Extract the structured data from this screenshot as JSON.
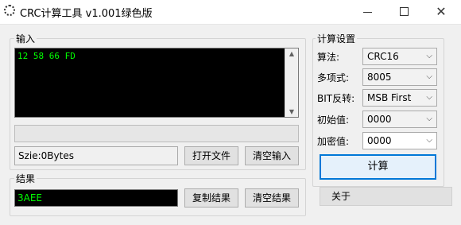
{
  "window": {
    "title": "CRC计算工具 v1.001绿色版",
    "controls": {
      "minimize": "minimize-icon",
      "maximize": "maximize-icon",
      "close": "✕"
    }
  },
  "input_group": {
    "label": "输入",
    "text": "12 58 66 FD",
    "progress": 0,
    "size_text": "Szie:0Bytes",
    "open_file_label": "打开文件",
    "clear_input_label": "清空输入"
  },
  "result_group": {
    "label": "结果",
    "value": "3AEE",
    "copy_label": "复制结果",
    "clear_result_label": "清空结果"
  },
  "settings": {
    "label": "计算设置",
    "algorithm": {
      "label": "算法:",
      "value": "CRC16"
    },
    "polynomial": {
      "label": "多项式:",
      "value": "8005"
    },
    "bit_reverse": {
      "label": "BIT反转:",
      "value": "MSB First"
    },
    "initial": {
      "label": "初始值:",
      "value": "0000"
    },
    "xor": {
      "label": "加密值:",
      "value": "0000"
    },
    "calc_label": "计算",
    "about_label": "关于"
  },
  "colors": {
    "terminal_bg": "#000000",
    "terminal_text": "#00ff00",
    "focus_border": "#0078d7"
  }
}
